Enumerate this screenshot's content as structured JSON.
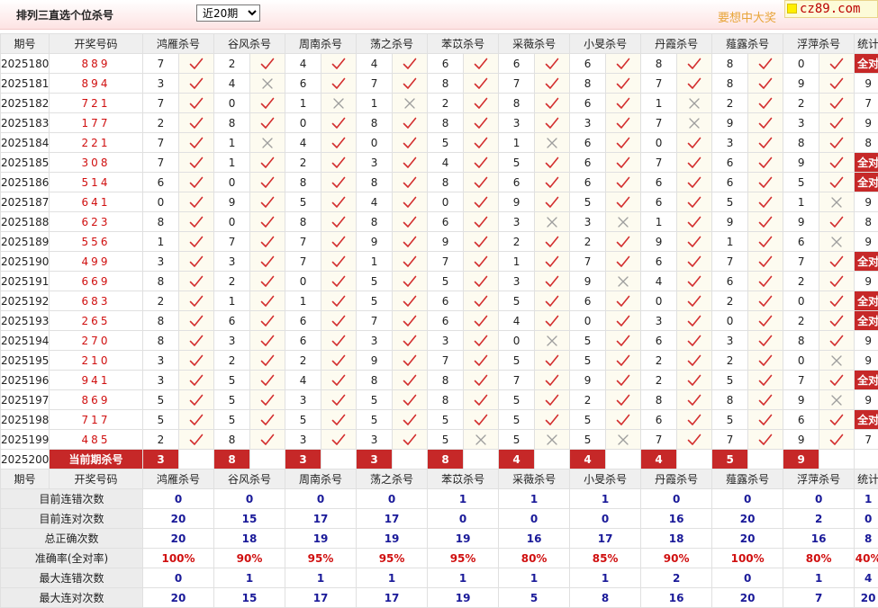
{
  "header": {
    "title": "排列三直选个位杀号",
    "period_select": {
      "value": "近20期",
      "options": [
        "近20期"
      ]
    },
    "slogan": "要想中大奖",
    "logo_text": "cz89.com"
  },
  "columns": {
    "issue": "期号",
    "draw": "开奖号码",
    "experts": [
      "鸿雁杀号",
      "谷风杀号",
      "周南杀号",
      "荡之杀号",
      "苯苡杀号",
      "采薇杀号",
      "小旻杀号",
      "丹霞杀号",
      "薤露杀号",
      "浮萍杀号"
    ],
    "total": "统计"
  },
  "rows": [
    {
      "issue": "2025180",
      "draw": "889",
      "kills": [
        7,
        2,
        4,
        4,
        6,
        6,
        6,
        8,
        8,
        0
      ],
      "hits": [
        1,
        1,
        1,
        1,
        1,
        1,
        1,
        1,
        1,
        1
      ],
      "total": "全对"
    },
    {
      "issue": "2025181",
      "draw": "894",
      "kills": [
        3,
        4,
        6,
        7,
        8,
        7,
        8,
        7,
        8,
        9
      ],
      "hits": [
        1,
        0,
        1,
        1,
        1,
        1,
        1,
        1,
        1,
        1
      ],
      "total": "9"
    },
    {
      "issue": "2025182",
      "draw": "721",
      "kills": [
        7,
        0,
        1,
        1,
        2,
        8,
        6,
        1,
        2,
        2
      ],
      "hits": [
        1,
        1,
        0,
        0,
        1,
        1,
        1,
        0,
        1,
        1
      ],
      "total": "7"
    },
    {
      "issue": "2025183",
      "draw": "177",
      "kills": [
        2,
        8,
        0,
        8,
        8,
        3,
        3,
        7,
        9,
        3
      ],
      "hits": [
        1,
        1,
        1,
        1,
        1,
        1,
        1,
        0,
        1,
        1
      ],
      "total": "9"
    },
    {
      "issue": "2025184",
      "draw": "221",
      "kills": [
        7,
        1,
        4,
        0,
        5,
        1,
        6,
        0,
        3,
        8
      ],
      "hits": [
        1,
        0,
        1,
        1,
        1,
        0,
        1,
        1,
        1,
        1
      ],
      "total": "8"
    },
    {
      "issue": "2025185",
      "draw": "308",
      "kills": [
        7,
        1,
        2,
        3,
        4,
        5,
        6,
        7,
        6,
        9
      ],
      "hits": [
        1,
        1,
        1,
        1,
        1,
        1,
        1,
        1,
        1,
        1
      ],
      "total": "全对"
    },
    {
      "issue": "2025186",
      "draw": "514",
      "kills": [
        6,
        0,
        8,
        8,
        8,
        6,
        6,
        6,
        6,
        5
      ],
      "hits": [
        1,
        1,
        1,
        1,
        1,
        1,
        1,
        1,
        1,
        1
      ],
      "total": "全对"
    },
    {
      "issue": "2025187",
      "draw": "641",
      "kills": [
        0,
        9,
        5,
        4,
        0,
        9,
        5,
        6,
        5,
        1
      ],
      "hits": [
        1,
        1,
        1,
        1,
        1,
        1,
        1,
        1,
        1,
        0
      ],
      "total": "9"
    },
    {
      "issue": "2025188",
      "draw": "623",
      "kills": [
        8,
        0,
        8,
        8,
        6,
        3,
        3,
        1,
        9,
        9
      ],
      "hits": [
        1,
        1,
        1,
        1,
        1,
        0,
        0,
        1,
        1,
        1
      ],
      "total": "8"
    },
    {
      "issue": "2025189",
      "draw": "556",
      "kills": [
        1,
        7,
        7,
        9,
        9,
        2,
        2,
        9,
        1,
        6
      ],
      "hits": [
        1,
        1,
        1,
        1,
        1,
        1,
        1,
        1,
        1,
        0
      ],
      "total": "9"
    },
    {
      "issue": "2025190",
      "draw": "499",
      "kills": [
        3,
        3,
        7,
        1,
        7,
        1,
        7,
        6,
        7,
        7
      ],
      "hits": [
        1,
        1,
        1,
        1,
        1,
        1,
        1,
        1,
        1,
        1
      ],
      "total": "全对"
    },
    {
      "issue": "2025191",
      "draw": "669",
      "kills": [
        8,
        2,
        0,
        5,
        5,
        3,
        9,
        4,
        6,
        2
      ],
      "hits": [
        1,
        1,
        1,
        1,
        1,
        1,
        0,
        1,
        1,
        1
      ],
      "total": "9"
    },
    {
      "issue": "2025192",
      "draw": "683",
      "kills": [
        2,
        1,
        1,
        5,
        6,
        5,
        6,
        0,
        2,
        0
      ],
      "hits": [
        1,
        1,
        1,
        1,
        1,
        1,
        1,
        1,
        1,
        1
      ],
      "total": "全对"
    },
    {
      "issue": "2025193",
      "draw": "265",
      "kills": [
        8,
        6,
        6,
        7,
        6,
        4,
        0,
        3,
        0,
        2
      ],
      "hits": [
        1,
        1,
        1,
        1,
        1,
        1,
        1,
        1,
        1,
        1
      ],
      "total": "全对"
    },
    {
      "issue": "2025194",
      "draw": "270",
      "kills": [
        8,
        3,
        6,
        3,
        3,
        0,
        5,
        6,
        3,
        8
      ],
      "hits": [
        1,
        1,
        1,
        1,
        1,
        0,
        1,
        1,
        1,
        1
      ],
      "total": "9"
    },
    {
      "issue": "2025195",
      "draw": "210",
      "kills": [
        3,
        2,
        2,
        9,
        7,
        5,
        5,
        2,
        2,
        0
      ],
      "hits": [
        1,
        1,
        1,
        1,
        1,
        1,
        1,
        1,
        1,
        0
      ],
      "total": "9"
    },
    {
      "issue": "2025196",
      "draw": "941",
      "kills": [
        3,
        5,
        4,
        8,
        8,
        7,
        9,
        2,
        5,
        7
      ],
      "hits": [
        1,
        1,
        1,
        1,
        1,
        1,
        1,
        1,
        1,
        1
      ],
      "total": "全对"
    },
    {
      "issue": "2025197",
      "draw": "869",
      "kills": [
        5,
        5,
        3,
        5,
        8,
        5,
        2,
        8,
        8,
        9
      ],
      "hits": [
        1,
        1,
        1,
        1,
        1,
        1,
        1,
        1,
        1,
        0
      ],
      "total": "9"
    },
    {
      "issue": "2025198",
      "draw": "717",
      "kills": [
        5,
        5,
        5,
        5,
        5,
        5,
        5,
        6,
        5,
        6
      ],
      "hits": [
        1,
        1,
        1,
        1,
        1,
        1,
        1,
        1,
        1,
        1
      ],
      "total": "全对"
    },
    {
      "issue": "2025199",
      "draw": "485",
      "kills": [
        2,
        8,
        3,
        3,
        5,
        5,
        5,
        7,
        7,
        9
      ],
      "hits": [
        1,
        1,
        1,
        1,
        0,
        0,
        0,
        1,
        1,
        1
      ],
      "total": "7"
    }
  ],
  "current": {
    "issue": "2025200",
    "label": "当前期杀号",
    "kills": [
      3,
      8,
      3,
      3,
      8,
      4,
      4,
      4,
      5,
      9
    ]
  },
  "stats": [
    {
      "label": "目前连错次数",
      "values": [
        "0",
        "0",
        "0",
        "0",
        "1",
        "1",
        "1",
        "0",
        "0",
        "0"
      ],
      "total": "1",
      "type": "count"
    },
    {
      "label": "目前连对次数",
      "values": [
        "20",
        "15",
        "17",
        "17",
        "0",
        "0",
        "0",
        "16",
        "20",
        "2"
      ],
      "total": "0",
      "type": "count"
    },
    {
      "label": "总正确次数",
      "values": [
        "20",
        "18",
        "19",
        "19",
        "19",
        "16",
        "17",
        "18",
        "20",
        "16"
      ],
      "total": "8",
      "type": "count"
    },
    {
      "label": "准确率(全对率)",
      "values": [
        "100%",
        "90%",
        "95%",
        "95%",
        "95%",
        "80%",
        "85%",
        "90%",
        "100%",
        "80%"
      ],
      "total": "40%",
      "type": "rate"
    },
    {
      "label": "最大连错次数",
      "values": [
        "0",
        "1",
        "1",
        "1",
        "1",
        "1",
        "1",
        "2",
        "0",
        "1"
      ],
      "total": "4",
      "type": "count"
    },
    {
      "label": "最大连对次数",
      "values": [
        "20",
        "15",
        "17",
        "17",
        "19",
        "5",
        "8",
        "16",
        "20",
        "7"
      ],
      "total": "20",
      "type": "count"
    }
  ],
  "colors": {
    "accent_red": "#c62828",
    "draw_red": "#d01010",
    "check": "#d32f2f",
    "cross": "#9e9e9e",
    "stat_blue": "#1a1a99"
  }
}
